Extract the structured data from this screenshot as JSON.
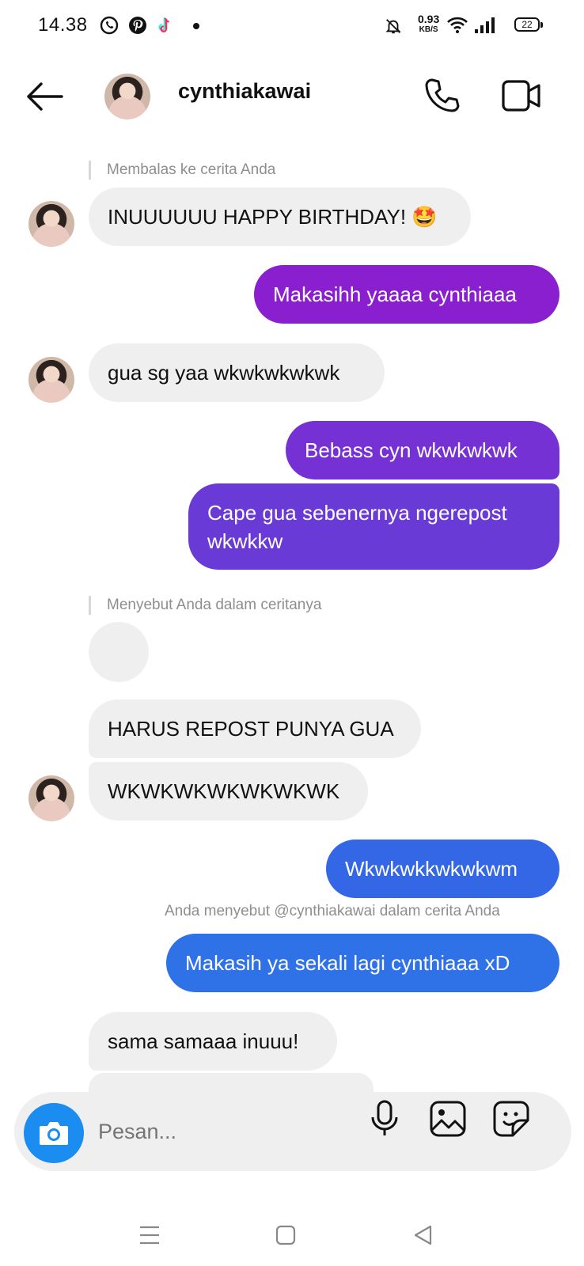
{
  "status_bar": {
    "time": "14.38",
    "speed_value": "0.93",
    "speed_unit": "KB/S",
    "battery": "22"
  },
  "header": {
    "username": "cynthiakawai"
  },
  "messages": [
    {
      "kind": "reply_note",
      "text": "Membalas ke cerita Anda"
    },
    {
      "kind": "incoming",
      "text": "INUUUUUU HAPPY BIRTHDAY! 🤩"
    },
    {
      "kind": "outgoing",
      "text": "Makasihh yaaaa cynthiaaa"
    },
    {
      "kind": "incoming",
      "text": "gua sg yaa wkwkwkwkwk"
    },
    {
      "kind": "outgoing",
      "text": "Bebass cyn wkwkwkwk"
    },
    {
      "kind": "outgoing",
      "text": "Cape gua sebenernya ngerepost wkwkkw"
    },
    {
      "kind": "reply_note",
      "text": "Menyebut Anda dalam ceritanya"
    },
    {
      "kind": "incoming",
      "text": "HARUS REPOST PUNYA GUA"
    },
    {
      "kind": "incoming",
      "text": "WKWKWKWKWKWKWK"
    },
    {
      "kind": "outgoing",
      "text": "Wkwkwkkwkwkwm"
    },
    {
      "kind": "note",
      "text": "Anda menyebut @cynthiakawai dalam cerita Anda"
    },
    {
      "kind": "outgoing",
      "text": "Makasih ya sekali lagi cynthiaaa xD"
    },
    {
      "kind": "incoming",
      "text": "sama samaaa inuuu!"
    }
  ],
  "composer": {
    "placeholder": "Pesan..."
  },
  "icons": [
    "back-arrow-icon",
    "phone-icon",
    "video-icon",
    "camera-icon",
    "microphone-icon",
    "image-icon",
    "sticker-icon",
    "menu-icon",
    "home-square-icon",
    "back-triangle-icon",
    "whatsapp-icon",
    "pinterest-icon",
    "tiktok-icon",
    "mute-icon",
    "wifi-icon",
    "signal-icon"
  ],
  "colors": {
    "outgoing_purple": "#8a1fd0",
    "outgoing_violet": "#6a3ad6",
    "outgoing_blue": "#2f72e8",
    "incoming_gray": "#efefef",
    "camera_blue": "#1b8cf0"
  }
}
